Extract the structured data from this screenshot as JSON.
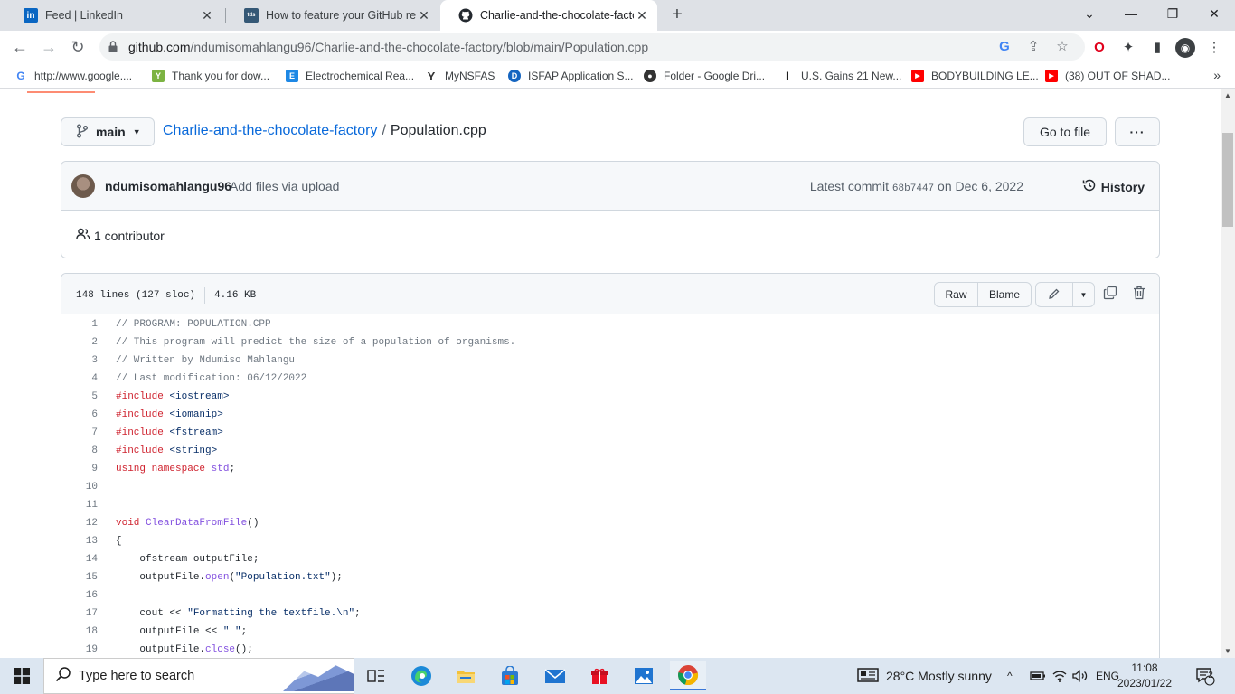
{
  "browser": {
    "tabs": [
      {
        "title": "Feed | LinkedIn",
        "icon": "linkedin-icon",
        "color": "#0a66c2",
        "glyph": "in"
      },
      {
        "title": "How to feature your GitHub repo",
        "icon": "tds-icon",
        "color": "#355876",
        "glyph": "tds"
      },
      {
        "title": "Charlie-and-the-chocolate-factor",
        "icon": "github-icon",
        "color": "#24292f",
        "glyph": ""
      }
    ],
    "new_tab": "+",
    "url_host": "github.com",
    "url_path": "/ndumisomahlangu96/Charlie-and-the-chocolate-factory/blob/main/Population.cpp"
  },
  "bookmarks": [
    {
      "label": "http://www.google....",
      "color": "#ffffff",
      "glyph": "G",
      "text_color": "#4285f4"
    },
    {
      "label": "Thank you for dow...",
      "color": "#7cb342",
      "glyph": "Y"
    },
    {
      "label": "Electrochemical Rea...",
      "color": "#1e88e5",
      "glyph": "E"
    },
    {
      "label": "MyNSFAS",
      "color": "#ffffff",
      "glyph": "Y",
      "text_color": "#333333"
    },
    {
      "label": "ISFAP Application S...",
      "color": "#1565c0",
      "glyph": "D"
    },
    {
      "label": "Folder - Google Dri...",
      "color": "#333333",
      "glyph": "●"
    },
    {
      "label": "U.S. Gains 21 New...",
      "color": "#ffffff",
      "glyph": "I",
      "text_color": "#111111"
    },
    {
      "label": "BODYBUILDING LE...",
      "color": "#ff0000",
      "glyph": "▶"
    },
    {
      "label": "(38) OUT OF SHAD...",
      "color": "#ff0000",
      "glyph": "▶"
    }
  ],
  "repo": {
    "branch": "main",
    "name": "Charlie-and-the-chocolate-factory",
    "separator": "/",
    "file": "Population.cpp",
    "go_to_file": "Go to file",
    "more": "···"
  },
  "commit": {
    "author": "ndumisomahlangu96",
    "message": "Add files via upload",
    "latest_label": "Latest commit",
    "sha": "68b7447",
    "date": "on Dec 6, 2022",
    "history": "History",
    "contributors": "1 contributor"
  },
  "file_header": {
    "lines": "148 lines (127 sloc)",
    "size": "4.16 KB",
    "raw": "Raw",
    "blame": "Blame"
  },
  "code_lines": [
    {
      "n": "1",
      "t": "// PROGRAM: POPULATION.CPP",
      "k": "comment"
    },
    {
      "n": "2",
      "t": "// This program will predict the size of a population of organisms.",
      "k": "comment"
    },
    {
      "n": "3",
      "t": "// Written by Ndumiso Mahlangu",
      "k": "comment"
    },
    {
      "n": "4",
      "t": "// Last modification: 06/12/2022",
      "k": "comment"
    },
    {
      "n": "5",
      "t": "#include <iostream>",
      "k": "include"
    },
    {
      "n": "6",
      "t": "#include <iomanip>",
      "k": "include"
    },
    {
      "n": "7",
      "t": "#include <fstream>",
      "k": "include"
    },
    {
      "n": "8",
      "t": "#include <string>",
      "k": "include"
    },
    {
      "n": "9",
      "t": "using namespace std;",
      "k": "using"
    },
    {
      "n": "10",
      "t": "",
      "k": "plain"
    },
    {
      "n": "11",
      "t": "",
      "k": "plain"
    },
    {
      "n": "12",
      "t": "void ClearDataFromFile()",
      "k": "func"
    },
    {
      "n": "13",
      "t": "{",
      "k": "plain"
    },
    {
      "n": "14",
      "t": "    ofstream outputFile;",
      "k": "plain"
    },
    {
      "n": "15",
      "t": "    outputFile.open(\"Population.txt\");",
      "k": "call"
    },
    {
      "n": "16",
      "t": "",
      "k": "plain"
    },
    {
      "n": "17",
      "t": "    cout << \"Formatting the textfile.\\n\";",
      "k": "string"
    },
    {
      "n": "18",
      "t": "    outputFile << \" \";",
      "k": "string"
    },
    {
      "n": "19",
      "t": "    outputFile.close();",
      "k": "call"
    }
  ],
  "taskbar": {
    "search_placeholder": "Type here to search",
    "weather": "28°C  Mostly sunny",
    "language": "ENG",
    "time": "11:08",
    "date": "2023/01/22",
    "notifications": "2"
  },
  "colors": {
    "link": "#0969da",
    "comment": "#6e7781",
    "keyword": "#cf222e",
    "entity": "#8250df",
    "string": "#0a3069"
  }
}
